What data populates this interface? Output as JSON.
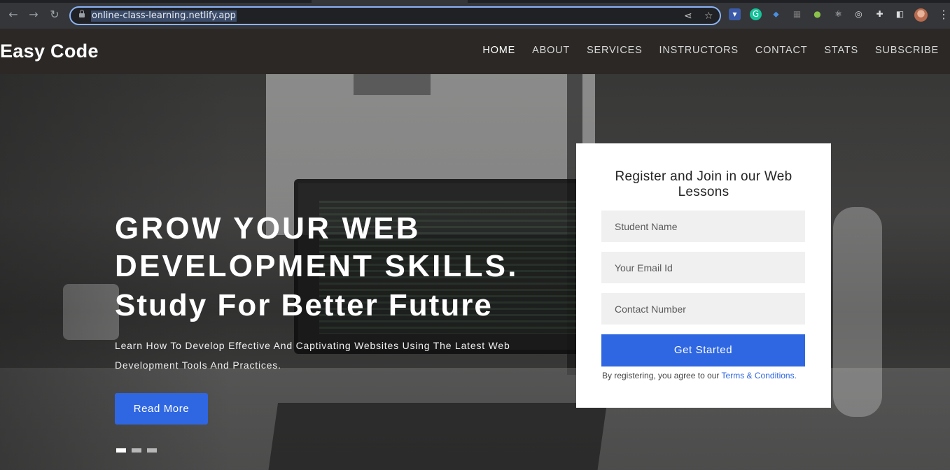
{
  "browser": {
    "url": "online-class-learning.netlify.app",
    "back_icon": "arrow-left-icon",
    "forward_icon": "arrow-right-icon",
    "reload_icon": "reload-icon",
    "share_icon": "share-icon",
    "bookmark_icon": "star-icon",
    "accent_color": "#8ab4f8"
  },
  "header": {
    "brand": "Easy Code",
    "nav": [
      "HOME",
      "ABOUT",
      "SERVICES",
      "INSTRUCTORS",
      "CONTACT",
      "STATS",
      "SUBSCRIBE"
    ],
    "active": "HOME"
  },
  "hero": {
    "title": "GROW YOUR WEB DEVELOPMENT SKILLS.",
    "subtitle": "Study For Better Future",
    "description": "Learn How To Develop Effective And Captivating Websites Using The Latest Web Development Tools And Practices.",
    "cta": "Read More",
    "slides": 3,
    "active_slide": 1
  },
  "register": {
    "title": "Register and Join in our Web Lessons",
    "name_placeholder": "Student Name",
    "email_placeholder": "Your Email Id",
    "phone_placeholder": "Contact Number",
    "submit": "Get Started",
    "terms_prefix": "By registering, you agree to our ",
    "terms_link": "Terms & Conditions."
  },
  "colors": {
    "primary": "#2f67e2",
    "header_bg": "#2b2826"
  }
}
